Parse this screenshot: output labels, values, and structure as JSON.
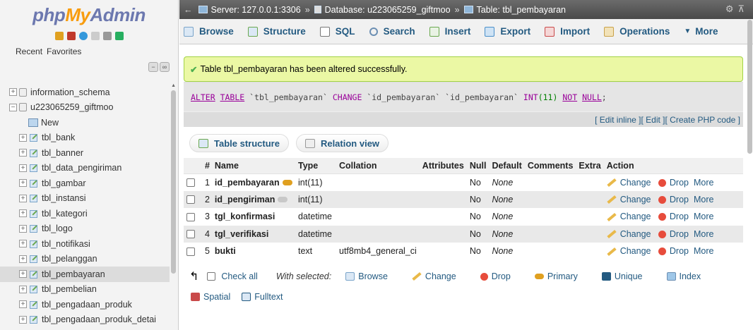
{
  "nav": {
    "logo_php": "php",
    "logo_my": "My",
    "logo_admin": "Admin",
    "tabs": [
      "Recent",
      "Favorites"
    ],
    "tree": [
      {
        "label": "information_schema",
        "type": "db"
      },
      {
        "label": "u223065259_giftmoo",
        "type": "db-open"
      },
      {
        "label": "New",
        "type": "new"
      },
      {
        "label": "tbl_bank",
        "type": "table"
      },
      {
        "label": "tbl_banner",
        "type": "table"
      },
      {
        "label": "tbl_data_pengiriman",
        "type": "table"
      },
      {
        "label": "tbl_gambar",
        "type": "table"
      },
      {
        "label": "tbl_instansi",
        "type": "table"
      },
      {
        "label": "tbl_kategori",
        "type": "table"
      },
      {
        "label": "tbl_logo",
        "type": "table"
      },
      {
        "label": "tbl_notifikasi",
        "type": "table"
      },
      {
        "label": "tbl_pelanggan",
        "type": "table"
      },
      {
        "label": "tbl_pembayaran",
        "type": "table",
        "selected": true
      },
      {
        "label": "tbl_pembelian",
        "type": "table"
      },
      {
        "label": "tbl_pengadaan_produk",
        "type": "table"
      },
      {
        "label": "tbl_pengadaan_produk_detai",
        "type": "table"
      }
    ]
  },
  "breadcrumb": {
    "server": "Server: 127.0.0.1:3306",
    "database": "Database: u223065259_giftmoo",
    "table": "Table: tbl_pembayaran",
    "separator": "»"
  },
  "tabs": {
    "browse": "Browse",
    "structure": "Structure",
    "sql": "SQL",
    "search": "Search",
    "insert": "Insert",
    "export": "Export",
    "import": "Import",
    "operations": "Operations",
    "more": "More"
  },
  "message": {
    "success": "Table tbl_pembayaran has been altered successfully."
  },
  "sql": {
    "kw1": "ALTER",
    "kw2": "TABLE",
    "t1": "`tbl_pembayaran`",
    "kw3": "CHANGE",
    "c1": "`id_pembayaran`",
    "c2": "`id_pembayaran`",
    "type": "INT",
    "num": "(11)",
    "kw4": "NOT",
    "kw5": "NULL",
    "end": ";"
  },
  "editlinks": {
    "inline": "[ Edit inline ]",
    "edit": "[ Edit ]",
    "php": "[ Create PHP code ]"
  },
  "views": {
    "table_structure": "Table structure",
    "relation_view": "Relation view"
  },
  "columns": {
    "num": "#",
    "name": "Name",
    "type": "Type",
    "collation": "Collation",
    "attributes": "Attributes",
    "null": "Null",
    "default": "Default",
    "comments": "Comments",
    "extra": "Extra",
    "action": "Action"
  },
  "rows": [
    {
      "num": "1",
      "name": "id_pembayaran",
      "key": "primary",
      "type": "int(11)",
      "collation": "",
      "null": "No",
      "default": "None"
    },
    {
      "num": "2",
      "name": "id_pengiriman",
      "key": "index",
      "type": "int(11)",
      "collation": "",
      "null": "No",
      "default": "None"
    },
    {
      "num": "3",
      "name": "tgl_konfirmasi",
      "key": "",
      "type": "datetime",
      "collation": "",
      "null": "No",
      "default": "None"
    },
    {
      "num": "4",
      "name": "tgl_verifikasi",
      "key": "",
      "type": "datetime",
      "collation": "",
      "null": "No",
      "default": "None"
    },
    {
      "num": "5",
      "name": "bukti",
      "key": "",
      "type": "text",
      "collation": "utf8mb4_general_ci",
      "null": "No",
      "default": "None"
    }
  ],
  "row_actions": {
    "change": "Change",
    "drop": "Drop",
    "more": "More"
  },
  "bulk": {
    "check_all": "Check all",
    "with_selected": "With selected:",
    "browse": "Browse",
    "change": "Change",
    "drop": "Drop",
    "primary": "Primary",
    "unique": "Unique",
    "index": "Index",
    "spatial": "Spatial",
    "fulltext": "Fulltext"
  },
  "colors": {
    "link": "#235a81",
    "success_bg": "#ebf8a4",
    "success_border": "#a2d246",
    "breadcrumb_bg": "#555555"
  }
}
